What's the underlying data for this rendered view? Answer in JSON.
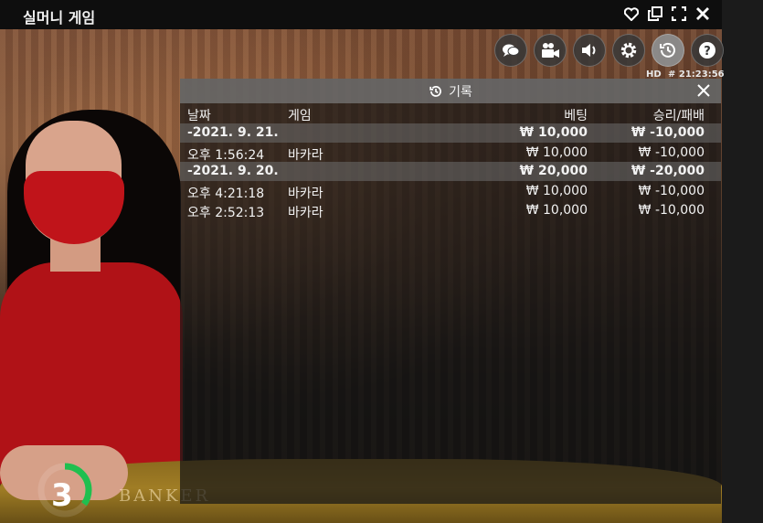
{
  "window": {
    "title": "실머니 게임",
    "icons": [
      "heart-icon",
      "copy-window-icon",
      "fullscreen-icon",
      "close-icon"
    ]
  },
  "video": {
    "table_text": "BANKER",
    "countdown": "3",
    "countdown_progress": 0.35
  },
  "controls": {
    "icons": [
      "chat-icon",
      "camera-icon",
      "volume-icon",
      "settings-icon",
      "history-icon",
      "help-icon"
    ],
    "hd_label": "HD",
    "clock": "# 21:23:56"
  },
  "history": {
    "title": "기록",
    "columns": {
      "date": "날짜",
      "game": "게임",
      "bet": "베팅",
      "result": "승리/패배"
    },
    "rows": [
      {
        "type": "group",
        "date": "-2021. 9. 21.",
        "game": "",
        "bet": "₩ 10,000",
        "result": "₩ -10,000"
      },
      {
        "type": "entry",
        "date": "오후 1:56:24",
        "game": "바카라",
        "bet": "₩ 10,000",
        "result": "₩ -10,000"
      },
      {
        "type": "group",
        "date": "-2021. 9. 20.",
        "game": "",
        "bet": "₩ 20,000",
        "result": "₩ -20,000"
      },
      {
        "type": "entry",
        "date": "오후 4:21:18",
        "game": "바카라",
        "bet": "₩ 10,000",
        "result": "₩ -10,000"
      },
      {
        "type": "entry",
        "date": "오후 2:52:13",
        "game": "바카라",
        "bet": "₩ 10,000",
        "result": "₩ -10,000"
      }
    ]
  },
  "colors": {
    "timer_green": "#1fbf4f",
    "panel_header": "#787878"
  }
}
